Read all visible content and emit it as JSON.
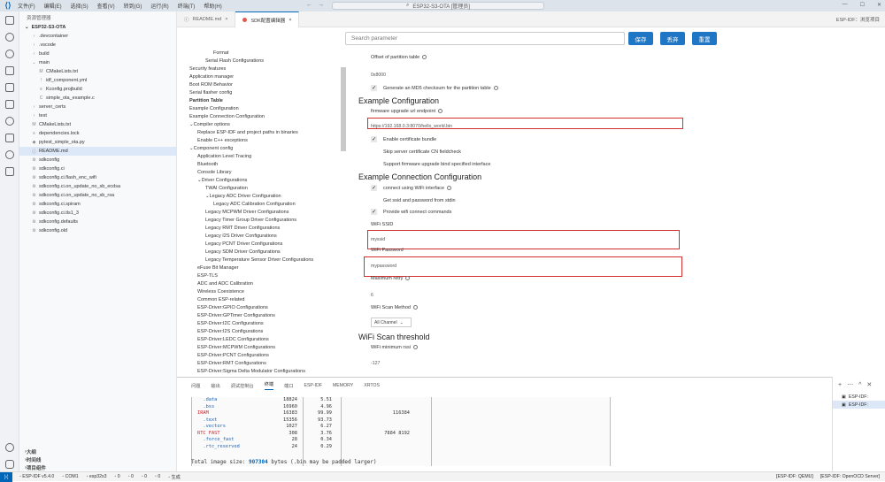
{
  "titlebar": {
    "menus": [
      "文件(F)",
      "编辑(E)",
      "选择(S)",
      "查看(V)",
      "转到(G)",
      "运行(R)",
      "终端(T)",
      "帮助(H)"
    ],
    "command_center": "ESP32-S3-OTA [管理员]"
  },
  "sidebar": {
    "title": "资源管理器",
    "root": "ESP32-S3-OTA",
    "items": [
      {
        "label": ".devcontainer",
        "icon": "chevron-right",
        "indent": 1
      },
      {
        "label": ".vscode",
        "icon": "chevron-right",
        "indent": 1
      },
      {
        "label": "build",
        "icon": "chevron-right",
        "indent": 1
      },
      {
        "label": "main",
        "icon": "chevron-down",
        "indent": 1
      },
      {
        "label": "CMakeLists.txt",
        "icon": "M",
        "indent": 2
      },
      {
        "label": "idf_component.yml",
        "icon": "!",
        "indent": 2
      },
      {
        "label": "Kconfig.projbuild",
        "icon": "≡",
        "indent": 2
      },
      {
        "label": "simple_ota_example.c",
        "icon": "C",
        "indent": 2
      },
      {
        "label": "server_certs",
        "icon": "chevron-right",
        "indent": 1
      },
      {
        "label": "test",
        "icon": "chevron-right",
        "indent": 1
      },
      {
        "label": "CMakeLists.txt",
        "icon": "M",
        "indent": 1
      },
      {
        "label": "dependencies.lock",
        "icon": "≡",
        "indent": 1
      },
      {
        "label": "pytest_simple_ota.py",
        "icon": "◆",
        "indent": 1
      },
      {
        "label": "README.md",
        "icon": "ⓘ",
        "indent": 1,
        "active": true
      },
      {
        "label": "sdkconfig",
        "icon": "⚙",
        "indent": 1
      },
      {
        "label": "sdkconfig.ci",
        "icon": "⚙",
        "indent": 1
      },
      {
        "label": "sdkconfig.ci.flash_enc_wifi",
        "icon": "⚙",
        "indent": 1
      },
      {
        "label": "sdkconfig.ci.on_update_no_sb_ecdsa",
        "icon": "⚙",
        "indent": 1
      },
      {
        "label": "sdkconfig.ci.on_update_no_sb_rsa",
        "icon": "⚙",
        "indent": 1
      },
      {
        "label": "sdkconfig.ci.spiram",
        "icon": "⚙",
        "indent": 1
      },
      {
        "label": "sdkconfig.ci.tls1_3",
        "icon": "⚙",
        "indent": 1
      },
      {
        "label": "sdkconfig.defaults",
        "icon": "⚙",
        "indent": 1
      },
      {
        "label": "sdkconfig.old",
        "icon": "⚙",
        "indent": 1
      }
    ],
    "bottom_sections": [
      "大纲",
      "时间线",
      "项目组件"
    ]
  },
  "tabs": [
    {
      "label": "README.md",
      "active": false
    },
    {
      "label": "SDK配置编辑器",
      "active": true
    }
  ],
  "tab_right": "ESP-IDF：浏览项目",
  "editor": {
    "search_placeholder": "Search parameter",
    "buttons": {
      "save": "保存",
      "discard": "丢弃",
      "reset": "重置"
    },
    "nav": [
      {
        "label": "Format",
        "indent": 3
      },
      {
        "label": "Serial Flash Configurations",
        "indent": 2
      },
      {
        "label": "Security features",
        "indent": 0
      },
      {
        "label": "Application manager",
        "indent": 0
      },
      {
        "label": "Boot ROM Behavior",
        "indent": 0
      },
      {
        "label": "Serial flasher config",
        "indent": 0
      },
      {
        "label": "Partition Table",
        "indent": 0,
        "selected": true
      },
      {
        "label": "Example Configuration",
        "indent": 0
      },
      {
        "label": "Example Connection Configuration",
        "indent": 0
      },
      {
        "label": "Compiler options",
        "indent": 0,
        "chevron": "⌄"
      },
      {
        "label": "Replace ESP-IDF and project paths in binaries",
        "indent": 1
      },
      {
        "label": "Enable C++ exceptions",
        "indent": 1
      },
      {
        "label": "Component config",
        "indent": 0,
        "chevron": "⌄"
      },
      {
        "label": "Application Level Tracing",
        "indent": 1
      },
      {
        "label": "Bluetooth",
        "indent": 1
      },
      {
        "label": "Console Library",
        "indent": 1
      },
      {
        "label": "Driver Configurations",
        "indent": 1,
        "chevron": "⌄"
      },
      {
        "label": "TWAI Configuration",
        "indent": 2
      },
      {
        "label": "Legacy ADC Driver Configuration",
        "indent": 2,
        "chevron": "⌄"
      },
      {
        "label": "Legacy ADC Calibration Configuration",
        "indent": 3
      },
      {
        "label": "Legacy MCPWM Driver Configurations",
        "indent": 2
      },
      {
        "label": "Legacy Timer Group Driver Configurations",
        "indent": 2
      },
      {
        "label": "Legacy RMT Driver Configurations",
        "indent": 2
      },
      {
        "label": "Legacy I2S Driver Configurations",
        "indent": 2
      },
      {
        "label": "Legacy PCNT Driver Configurations",
        "indent": 2
      },
      {
        "label": "Legacy SDM Driver Configurations",
        "indent": 2
      },
      {
        "label": "Legacy Temperature Sensor Driver Configurations",
        "indent": 2
      },
      {
        "label": "eFuse Bit Manager",
        "indent": 1
      },
      {
        "label": "ESP-TLS",
        "indent": 1
      },
      {
        "label": "ADC and ADC Calibration",
        "indent": 1
      },
      {
        "label": "Wireless Coexistence",
        "indent": 1
      },
      {
        "label": "Common ESP-related",
        "indent": 1
      },
      {
        "label": "ESP-Driver:GPIO Configurations",
        "indent": 1
      },
      {
        "label": "ESP-Driver:GPTimer Configurations",
        "indent": 1
      },
      {
        "label": "ESP-Driver:I2C Configurations",
        "indent": 1
      },
      {
        "label": "ESP-Driver:I2S Configurations",
        "indent": 1
      },
      {
        "label": "ESP-Driver:LEDC Configurations",
        "indent": 1
      },
      {
        "label": "ESP-Driver:MCPWM Configurations",
        "indent": 1
      },
      {
        "label": "ESP-Driver:PCNT Configurations",
        "indent": 1
      },
      {
        "label": "ESP-Driver:RMT Configurations",
        "indent": 1
      },
      {
        "label": "ESP-Driver:Sigma Delta Modulator Configurations",
        "indent": 1
      }
    ],
    "panel": {
      "offset_label": "Offset of partition table",
      "offset_value": "0x8000",
      "md5_label": "Generate an MD5 checksum for the partition table",
      "section_example": "Example Configuration",
      "url_label": "firmware upgrade url endpoint",
      "url_value": "https://192.168.0.3:8070/hello_world.bin",
      "cert_bundle": "Enable certificate bundle",
      "skip_cn": "Skip server certificate CN fieldcheck",
      "bind_if": "Support firmware upgrade bind specified interface",
      "section_connection": "Example Connection Configuration",
      "connect_wifi": "connect using WiFi interface",
      "get_ssid": "Get ssid and password from stdin",
      "provide_cmds": "Provide wifi connect commands",
      "ssid_label": "WiFi SSID",
      "ssid_value": "myssid",
      "pwd_label": "WiFi Password",
      "pwd_value": "mypassword",
      "retry_label": "Maximum retry",
      "retry_value": "6",
      "scan_method_label": "WiFi Scan Method",
      "scan_method_value": "All Channel",
      "section_threshold": "WiFi Scan threshold",
      "rssi_label": "WiFi minimum rssi",
      "rssi_value": "-127"
    }
  },
  "panel_tabs": [
    "问题",
    "输出",
    "调试控制台",
    "终端",
    "端口",
    "ESP-IDF",
    "MEMORY",
    "XRTOS"
  ],
  "terminal": {
    "rows": [
      {
        "name": "  .data",
        "size": "18824",
        "pct": "5.51",
        "c3": "",
        "c4": "",
        "color": "#1a5fb4"
      },
      {
        "name": "  .bss",
        "size": "16960",
        "pct": "4.96",
        "c3": "",
        "c4": "",
        "color": "#1a5fb4"
      },
      {
        "name": "IRAM",
        "size": "16383",
        "pct": "99.99",
        "c3": "1",
        "c4": "16384",
        "color": "#c6262e"
      },
      {
        "name": "  .text",
        "size": "15356",
        "pct": "93.73",
        "c3": "",
        "c4": "",
        "color": "#1a5fb4"
      },
      {
        "name": "  .vectors",
        "size": "1027",
        "pct": "6.27",
        "c3": "",
        "c4": "",
        "color": "#1a5fb4"
      },
      {
        "name": "RTC FAST",
        "size": "308",
        "pct": "3.76",
        "c3": "7884",
        "c4": "8192",
        "color": "#c6262e"
      },
      {
        "name": "  .force_fast",
        "size": "28",
        "pct": "0.34",
        "c3": "",
        "c4": "",
        "color": "#1a5fb4"
      },
      {
        "name": "  .rtc_reserved",
        "size": "24",
        "pct": "0.29",
        "c3": "",
        "c4": "",
        "color": "#1a5fb4"
      }
    ],
    "total_prefix": "Total image size: ",
    "total_value": "907304",
    "total_suffix": " bytes (.bin may be padded larger)"
  },
  "terminal_list": [
    "ESP-IDF:",
    "ESP-IDF:"
  ],
  "statusbar": {
    "left": [
      "ESP-IDF v5.4.0",
      "COM1",
      "esp32s3",
      "0",
      "0",
      "0",
      "0",
      "生成"
    ],
    "right": [
      "[ESP-IDF: QEMU]",
      "[ESP-IDF: OpenOCD Server]"
    ]
  }
}
